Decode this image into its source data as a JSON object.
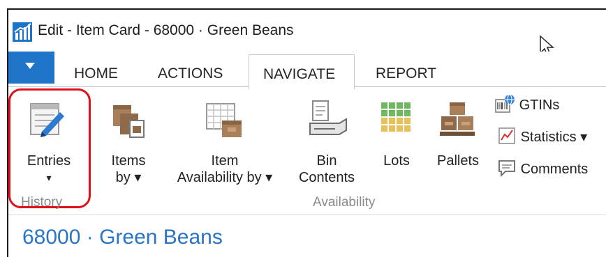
{
  "window": {
    "title": "Edit - Item Card - 68000 · Green Beans"
  },
  "tabs": [
    {
      "label": "HOME"
    },
    {
      "label": "ACTIONS"
    },
    {
      "label": "NAVIGATE",
      "active": true
    },
    {
      "label": "REPORT"
    }
  ],
  "ribbon": {
    "groups": {
      "history": "History",
      "availability": "Availability"
    },
    "buttons": {
      "entries": {
        "line1": "Entries",
        "arrow": "▾"
      },
      "items_by": {
        "line1": "Items",
        "line2": "by ▾"
      },
      "item_availability": {
        "line1": "Item",
        "line2": "Availability by ▾"
      },
      "bin_contents": {
        "line1": "Bin",
        "line2": "Contents"
      },
      "lots": {
        "line1": "Lots"
      },
      "pallets": {
        "line1": "Pallets"
      },
      "gtins": "GTINs",
      "statistics": "Statistics ▾",
      "comments": "Comments"
    }
  },
  "page": {
    "title": "68000 · Green Beans"
  },
  "colors": {
    "accent_blue": "#1e74c8",
    "title_blue": "#2a74c6",
    "highlight_red": "#e0101a",
    "group_label_gray": "#8a8a8a"
  },
  "icons": [
    "app-logo-icon",
    "app-menu-chevron-icon",
    "entries-icon",
    "items-by-icon",
    "item-availability-icon",
    "bin-contents-icon",
    "lots-icon",
    "pallets-icon",
    "gtins-icon",
    "statistics-icon",
    "comments-icon",
    "mouse-cursor-icon"
  ]
}
